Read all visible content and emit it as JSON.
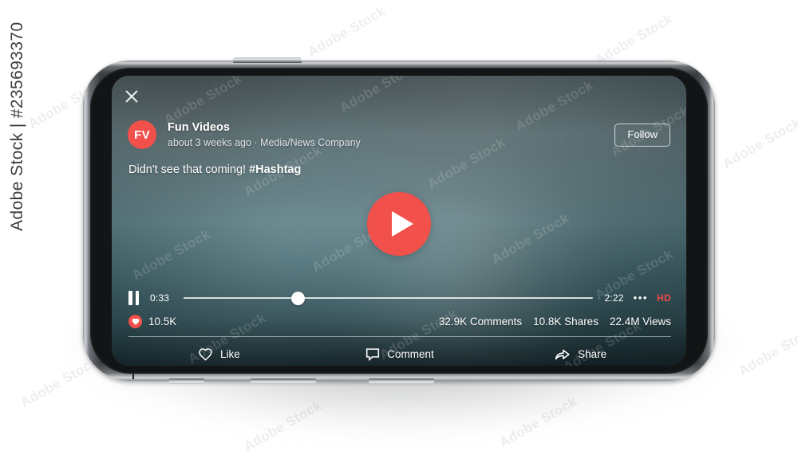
{
  "watermark": {
    "vertical": "Adobe Stock | #235693370",
    "tile": "Adobe Stock"
  },
  "player": {
    "close_icon": "close-icon",
    "post": {
      "avatar_initials": "FV",
      "channel_name": "Fun Videos",
      "meta": "about 3 weeks ago · Media/News Company",
      "follow_label": "Follow",
      "caption_text": "Didn't see that coming! ",
      "caption_hashtag": "#Hashtag"
    },
    "play_button": {
      "icon": "play-icon",
      "color": "#F2504B"
    },
    "transport": {
      "pause_icon": "pause-icon",
      "current_time": "0:33",
      "duration": "2:22",
      "more_icon": "•••",
      "quality_badge": "HD",
      "quality_color": "#EF4A46",
      "progress_percent": 28
    },
    "stats": {
      "like_icon": "heart-filled-icon",
      "like_count": "10.5K",
      "comments": "32.9K Comments",
      "shares": "10.8K Shares",
      "views": "22.4M Views"
    },
    "actions": [
      {
        "icon": "heart-outline-icon",
        "label": "Like"
      },
      {
        "icon": "comment-bubble-icon",
        "label": "Comment"
      },
      {
        "icon": "share-arrow-icon",
        "label": "Share"
      }
    ]
  }
}
